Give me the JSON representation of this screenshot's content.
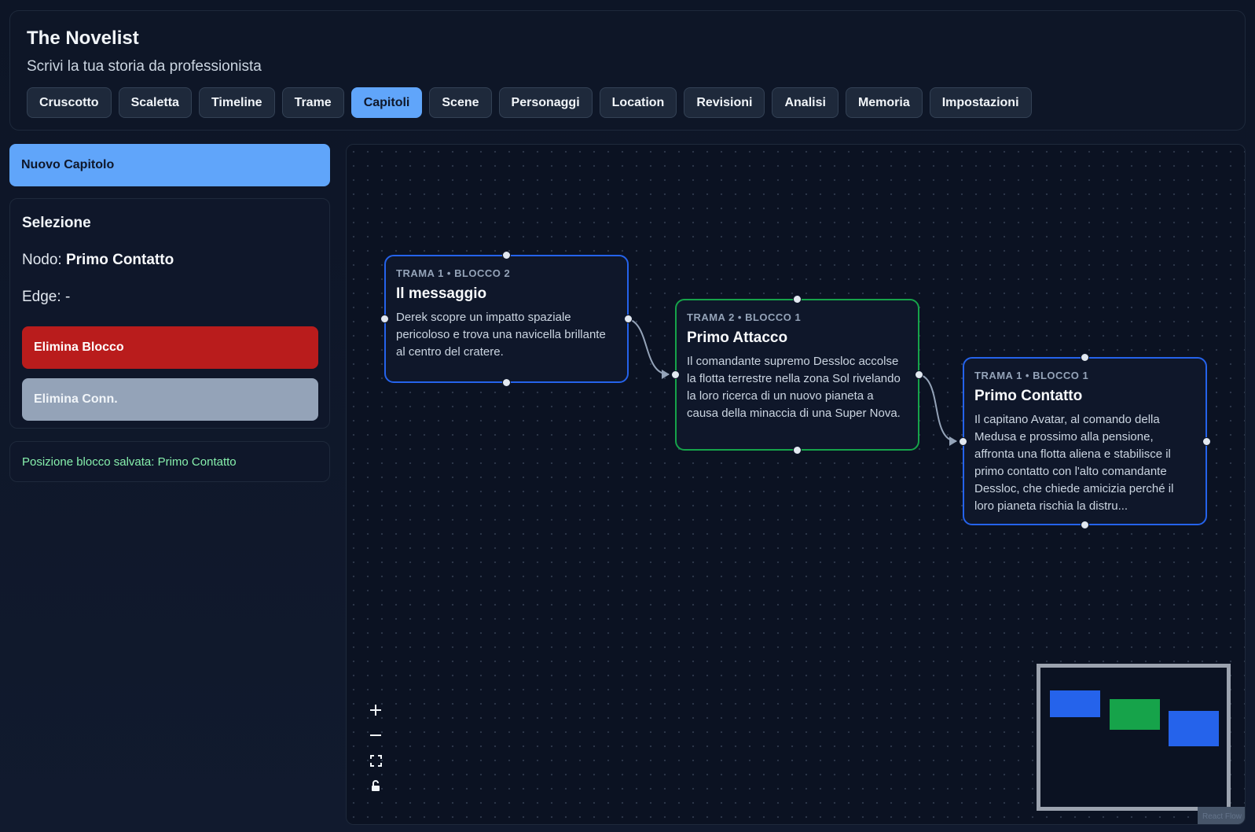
{
  "app": {
    "title": "The Novelist",
    "subtitle": "Scrivi la tua storia da professionista"
  },
  "tabs": [
    {
      "label": "Cruscotto",
      "active": false
    },
    {
      "label": "Scaletta",
      "active": false
    },
    {
      "label": "Timeline",
      "active": false
    },
    {
      "label": "Trame",
      "active": false
    },
    {
      "label": "Capitoli",
      "active": true
    },
    {
      "label": "Scene",
      "active": false
    },
    {
      "label": "Personaggi",
      "active": false
    },
    {
      "label": "Location",
      "active": false
    },
    {
      "label": "Revisioni",
      "active": false
    },
    {
      "label": "Analisi",
      "active": false
    },
    {
      "label": "Memoria",
      "active": false
    },
    {
      "label": "Impostazioni",
      "active": false
    }
  ],
  "sidebar": {
    "new_chapter_label": "Nuovo Capitolo",
    "selection": {
      "title": "Selezione",
      "node_label": "Nodo:",
      "node_value": "Primo Contatto",
      "edge_label": "Edge:",
      "edge_value": "-",
      "delete_block_label": "Elimina Blocco",
      "delete_conn_label": "Elimina Conn."
    },
    "status": "Posizione blocco salvata: Primo Contatto"
  },
  "nodes": [
    {
      "tag": "TRAMA 1 • BLOCCO 2",
      "title": "Il messaggio",
      "description": "Derek scopre un impatto spaziale pericoloso e trova una navicella brillante al centro del cratere.",
      "color": "#2563eb"
    },
    {
      "tag": "TRAMA 2 • BLOCCO 1",
      "title": "Primo Attacco",
      "description": "Il comandante supremo Dessloc accolse la flotta terrestre nella zona Sol rivelando la loro ricerca di un nuovo pianeta a causa della minaccia di una Super Nova.",
      "color": "#16a34a"
    },
    {
      "tag": "TRAMA 1 • BLOCCO 1",
      "title": "Primo Contatto",
      "description": "Il capitano Avatar, al comando della Medusa e prossimo alla pensione, affronta una flotta aliena e stabilisce il primo contatto con l'alto comandante Dessloc, che chiede amicizia perché il loro pianeta rischia la distru...",
      "color": "#2563eb"
    }
  ],
  "controls": {
    "zoom_in_icon": "plus-icon",
    "zoom_out_icon": "minus-icon",
    "fit_view_icon": "fit-view-icon",
    "lock_icon": "lock-icon"
  },
  "attribution": "React Flow",
  "colors": {
    "accent": "#60a5fa",
    "danger": "#b91c1c",
    "muted": "#94a3b8",
    "success_text": "#86efac",
    "plot_blue": "#2563eb",
    "plot_green": "#16a34a"
  }
}
